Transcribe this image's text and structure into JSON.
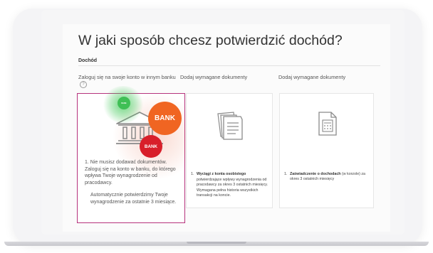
{
  "page": {
    "title": "W jaki sposób chcesz potwierdzić dochód?",
    "section_label": "Dochód"
  },
  "options": [
    {
      "heading": "Zaloguj się na swoje konto w innym banku",
      "help_icon": "?",
      "paragraph_1": "1. Nie musisz dodawać dokumentów. Zaloguj się na konto w banku, do którego wpływa Twoje wynagrodzenie od pracodawcy.",
      "paragraph_2": "Automatycznie potwierdzimy Twoje wynagrodzenie za ostatnie 3 miesiące.",
      "selected": true,
      "icon": "bank-building-icon"
    },
    {
      "heading": "Dodaj wymagane dokumenty",
      "item_title": "Wyciągi z konta osobistego",
      "item_body": "potwierdzające wpływy wynagrodzenia od pracodawcy za okres 3 ostatnich miesięcy. Wymagana pełna historia wszystkich transakcji na koncie.",
      "item_number": "1.",
      "icon": "documents-stack-icon"
    },
    {
      "heading": "Dodaj wymagane dokumenty",
      "item_title": "Zaświadczenie o dochodach",
      "item_body": "(w korzole) za okres 3 ostatnich miesięcy",
      "item_number": "1.",
      "icon": "calculator-document-icon"
    }
  ],
  "badges": {
    "green": "BANK",
    "orange": "BANK",
    "red": "BANK"
  },
  "colors": {
    "selected_border": "#b6337d",
    "badge_green": "#3fbf55",
    "badge_orange": "#f06522",
    "badge_red": "#d81f2a"
  }
}
